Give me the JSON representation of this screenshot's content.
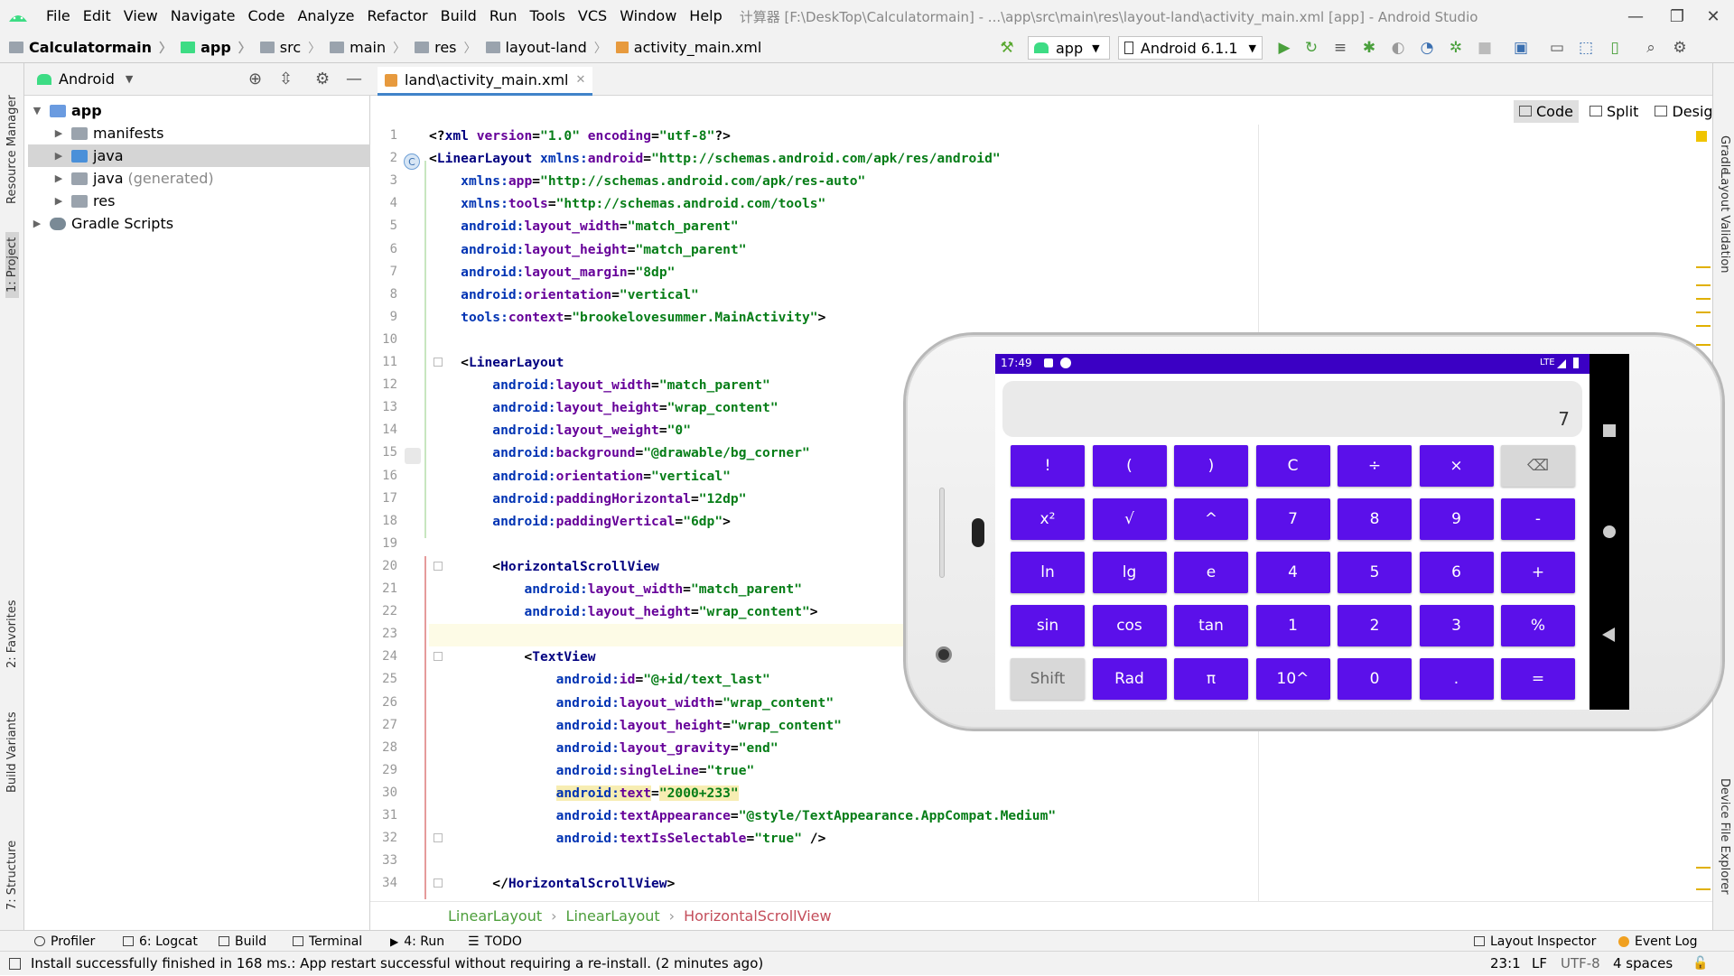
{
  "menubar": {
    "items": [
      "File",
      "Edit",
      "View",
      "Navigate",
      "Code",
      "Analyze",
      "Refactor",
      "Build",
      "Run",
      "Tools",
      "VCS",
      "Window",
      "Help"
    ],
    "title": "计算器 [F:\\DeskTop\\Calculatormain] - ...\\app\\src\\main\\res\\layout-land\\activity_main.xml [app] - Android Studio"
  },
  "breadcrumbs": [
    "Calculatormain",
    "app",
    "src",
    "main",
    "res",
    "layout-land",
    "activity_main.xml"
  ],
  "toolbar": {
    "run_config": "app",
    "device": "Android 6.1.1"
  },
  "project_panel": {
    "view": "Android",
    "tree": [
      {
        "label": "app",
        "level": 0,
        "expanded": true,
        "bold": true
      },
      {
        "label": "manifests",
        "level": 1,
        "expanded": false
      },
      {
        "label": "java",
        "level": 1,
        "expanded": false,
        "selected": true
      },
      {
        "label": "java",
        "suffix": "(generated)",
        "level": 1,
        "expanded": false
      },
      {
        "label": "res",
        "level": 1,
        "expanded": false
      },
      {
        "label": "Gradle Scripts",
        "level": 0,
        "expanded": false
      }
    ]
  },
  "left_strip": [
    "Resource Manager",
    "1: Project",
    "2: Favorites",
    "Build Variants",
    "7: Structure"
  ],
  "right_strip": [
    "Gradle",
    "Layout Validation",
    "Device File Explorer"
  ],
  "editor": {
    "tab": "land\\activity_main.xml",
    "modes": [
      "Code",
      "Split",
      "Design"
    ],
    "lines": [
      [
        [
          "punc",
          "<?"
        ],
        [
          "tag",
          "xml "
        ],
        [
          "attr",
          "version"
        ],
        [
          "punc",
          "="
        ],
        [
          "val",
          "\"1.0\" "
        ],
        [
          "attr",
          "encoding"
        ],
        [
          "punc",
          "="
        ],
        [
          "val",
          "\"utf-8\""
        ],
        [
          "punc",
          "?>"
        ]
      ],
      [
        [
          "punc",
          "<"
        ],
        [
          "tag",
          "LinearLayout "
        ],
        [
          "ns",
          "xmlns:"
        ],
        [
          "attr",
          "android"
        ],
        [
          "punc",
          "="
        ],
        [
          "val",
          "\"http://schemas.android.com/apk/res/android\""
        ]
      ],
      [
        [
          "punc",
          "    "
        ],
        [
          "ns",
          "xmlns:"
        ],
        [
          "attr",
          "app"
        ],
        [
          "punc",
          "="
        ],
        [
          "val",
          "\"http://schemas.android.com/apk/res-auto\""
        ]
      ],
      [
        [
          "punc",
          "    "
        ],
        [
          "ns",
          "xmlns:"
        ],
        [
          "attr",
          "tools"
        ],
        [
          "punc",
          "="
        ],
        [
          "val",
          "\"http://schemas.android.com/tools\""
        ]
      ],
      [
        [
          "punc",
          "    "
        ],
        [
          "ns",
          "android:"
        ],
        [
          "attr",
          "layout_width"
        ],
        [
          "punc",
          "="
        ],
        [
          "val",
          "\"match_parent\""
        ]
      ],
      [
        [
          "punc",
          "    "
        ],
        [
          "ns",
          "android:"
        ],
        [
          "attr",
          "layout_height"
        ],
        [
          "punc",
          "="
        ],
        [
          "val",
          "\"match_parent\""
        ]
      ],
      [
        [
          "punc",
          "    "
        ],
        [
          "ns",
          "android:"
        ],
        [
          "attr",
          "layout_margin"
        ],
        [
          "punc",
          "="
        ],
        [
          "val",
          "\"8dp\""
        ]
      ],
      [
        [
          "punc",
          "    "
        ],
        [
          "ns",
          "android:"
        ],
        [
          "attr",
          "orientation"
        ],
        [
          "punc",
          "="
        ],
        [
          "val",
          "\"vertical\""
        ]
      ],
      [
        [
          "punc",
          "    "
        ],
        [
          "ns",
          "tools:"
        ],
        [
          "attr",
          "context"
        ],
        [
          "punc",
          "="
        ],
        [
          "val",
          "\"brookelovesummer.MainActivity\""
        ],
        [
          "punc",
          ">"
        ]
      ],
      [
        [
          "punc",
          ""
        ]
      ],
      [
        [
          "punc",
          "    <"
        ],
        [
          "tag",
          "LinearLayout"
        ]
      ],
      [
        [
          "punc",
          "        "
        ],
        [
          "ns",
          "android:"
        ],
        [
          "attr",
          "layout_width"
        ],
        [
          "punc",
          "="
        ],
        [
          "val",
          "\"match_parent\""
        ]
      ],
      [
        [
          "punc",
          "        "
        ],
        [
          "ns",
          "android:"
        ],
        [
          "attr",
          "layout_height"
        ],
        [
          "punc",
          "="
        ],
        [
          "val",
          "\"wrap_content\""
        ]
      ],
      [
        [
          "punc",
          "        "
        ],
        [
          "ns",
          "android:"
        ],
        [
          "attr",
          "layout_weight"
        ],
        [
          "punc",
          "="
        ],
        [
          "val",
          "\"0\""
        ]
      ],
      [
        [
          "punc",
          "        "
        ],
        [
          "ns",
          "android:"
        ],
        [
          "attr",
          "background"
        ],
        [
          "punc",
          "="
        ],
        [
          "val",
          "\"@drawable/bg_corner\""
        ]
      ],
      [
        [
          "punc",
          "        "
        ],
        [
          "ns",
          "android:"
        ],
        [
          "attr",
          "orientation"
        ],
        [
          "punc",
          "="
        ],
        [
          "val",
          "\"vertical\""
        ]
      ],
      [
        [
          "punc",
          "        "
        ],
        [
          "ns",
          "android:"
        ],
        [
          "attr",
          "paddingHorizontal"
        ],
        [
          "punc",
          "="
        ],
        [
          "val",
          "\"12dp\""
        ]
      ],
      [
        [
          "punc",
          "        "
        ],
        [
          "ns",
          "android:"
        ],
        [
          "attr",
          "paddingVertical"
        ],
        [
          "punc",
          "="
        ],
        [
          "val",
          "\"6dp\""
        ],
        [
          "punc",
          ">"
        ]
      ],
      [
        [
          "punc",
          ""
        ]
      ],
      [
        [
          "punc",
          "        <"
        ],
        [
          "tag",
          "HorizontalScrollView"
        ]
      ],
      [
        [
          "punc",
          "            "
        ],
        [
          "ns",
          "android:"
        ],
        [
          "attr",
          "layout_width"
        ],
        [
          "punc",
          "="
        ],
        [
          "val",
          "\"match_parent\""
        ]
      ],
      [
        [
          "punc",
          "            "
        ],
        [
          "ns",
          "android:"
        ],
        [
          "attr",
          "layout_height"
        ],
        [
          "punc",
          "="
        ],
        [
          "val",
          "\"wrap_content\""
        ],
        [
          "punc",
          ">"
        ]
      ],
      [
        [
          "punc",
          ""
        ]
      ],
      [
        [
          "punc",
          "            <"
        ],
        [
          "tag",
          "TextView"
        ]
      ],
      [
        [
          "punc",
          "                "
        ],
        [
          "ns",
          "android:"
        ],
        [
          "attr",
          "id"
        ],
        [
          "punc",
          "="
        ],
        [
          "val",
          "\"@+id/text_last\""
        ]
      ],
      [
        [
          "punc",
          "                "
        ],
        [
          "ns",
          "android:"
        ],
        [
          "attr",
          "layout_width"
        ],
        [
          "punc",
          "="
        ],
        [
          "val",
          "\"wrap_content\""
        ]
      ],
      [
        [
          "punc",
          "                "
        ],
        [
          "ns",
          "android:"
        ],
        [
          "attr",
          "layout_height"
        ],
        [
          "punc",
          "="
        ],
        [
          "val",
          "\"wrap_content\""
        ]
      ],
      [
        [
          "punc",
          "                "
        ],
        [
          "ns",
          "android:"
        ],
        [
          "attr",
          "layout_gravity"
        ],
        [
          "punc",
          "="
        ],
        [
          "val",
          "\"end\""
        ]
      ],
      [
        [
          "punc",
          "                "
        ],
        [
          "ns",
          "android:"
        ],
        [
          "attr",
          "singleLine"
        ],
        [
          "punc",
          "="
        ],
        [
          "val",
          "\"true\""
        ]
      ],
      [
        [
          "punc",
          "                "
        ],
        [
          "ns",
          "android:"
        ],
        [
          "attr",
          "text"
        ],
        [
          "punc",
          "="
        ],
        [
          "val",
          "\"2000+233\""
        ]
      ],
      [
        [
          "punc",
          "                "
        ],
        [
          "ns",
          "android:"
        ],
        [
          "attr",
          "textAppearance"
        ],
        [
          "punc",
          "="
        ],
        [
          "val",
          "\"@style/TextAppearance.AppCompat.Medium\""
        ]
      ],
      [
        [
          "punc",
          "                "
        ],
        [
          "ns",
          "android:"
        ],
        [
          "attr",
          "textIsSelectable"
        ],
        [
          "punc",
          "="
        ],
        [
          "val",
          "\"true\" "
        ],
        [
          "punc",
          "/>"
        ]
      ],
      [
        [
          "punc",
          ""
        ]
      ],
      [
        [
          "punc",
          "        </"
        ],
        [
          "tag",
          "HorizontalScrollView"
        ],
        [
          "punc",
          ">"
        ]
      ]
    ]
  },
  "structure_breadcrumb": [
    "LinearLayout",
    "LinearLayout",
    "HorizontalScrollView"
  ],
  "tool_windows": [
    {
      "label": "Profiler"
    },
    {
      "label": "6: Logcat"
    },
    {
      "label": "Build"
    },
    {
      "label": "Terminal"
    },
    {
      "label": "4: Run"
    },
    {
      "label": "TODO"
    },
    {
      "label": "Layout Inspector"
    },
    {
      "label": "Event Log"
    }
  ],
  "status": {
    "message": "Install successfully finished in 168 ms.: App restart successful without requiring a re-install. (2 minutes ago)",
    "position": "23:1",
    "line_sep": "LF",
    "encoding": "UTF-8",
    "indent": "4 spaces"
  },
  "emulator": {
    "time": "17:49",
    "signal": "LTE",
    "display_value": "7",
    "keys": [
      [
        "!",
        "(",
        ")",
        "C",
        "÷",
        "×",
        "⌫"
      ],
      [
        "x²",
        "√",
        "^",
        "7",
        "8",
        "9",
        "-"
      ],
      [
        "ln",
        "lg",
        "e",
        "4",
        "5",
        "6",
        "+"
      ],
      [
        "sin",
        "cos",
        "tan",
        "1",
        "2",
        "3",
        "%"
      ],
      [
        "Shift",
        "Rad",
        "π",
        "10^",
        "0",
        ".",
        "="
      ]
    ],
    "accent": "#5b10ea",
    "statusbar_color": "#3b00c4"
  }
}
